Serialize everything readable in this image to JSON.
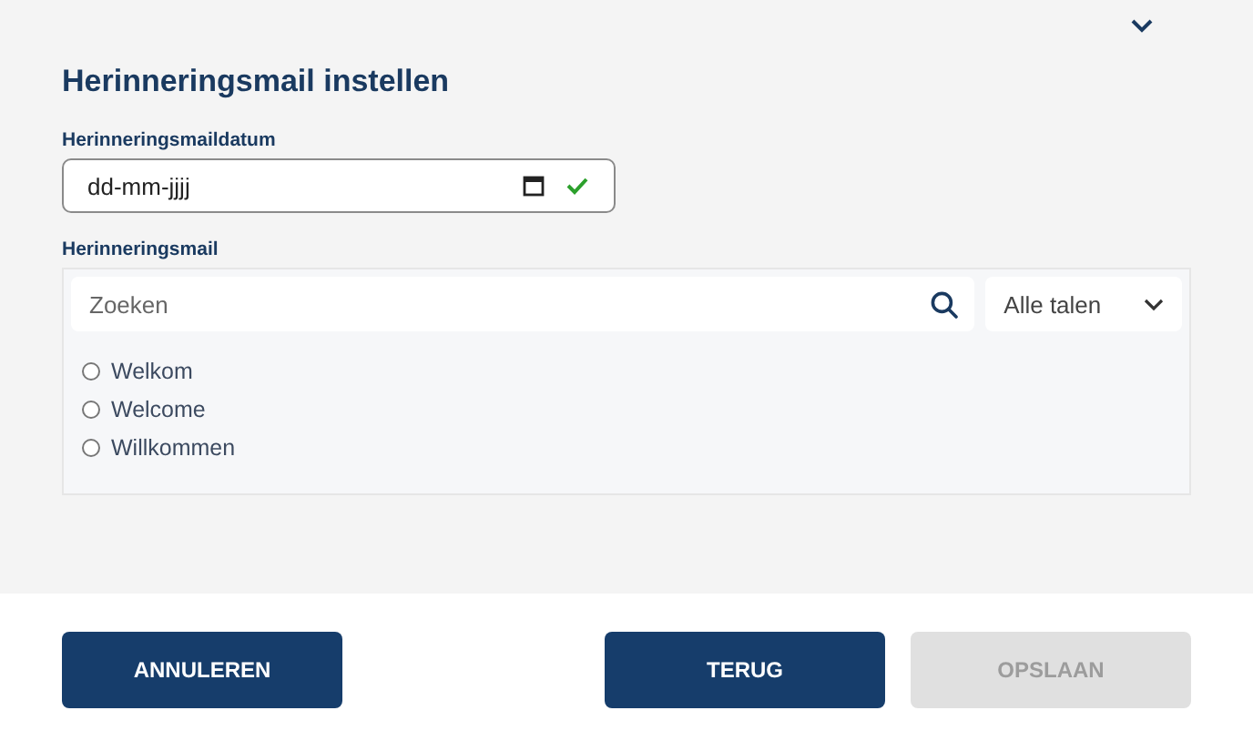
{
  "section": {
    "title": "Herinneringsmail instellen",
    "expanded": true
  },
  "date_field": {
    "label": "Herinneringsmaildatum",
    "placeholder": "dd-mm-jjjj",
    "valid": true
  },
  "mail_field": {
    "label": "Herinneringsmail",
    "search": {
      "placeholder": "Zoeken"
    },
    "language": {
      "value": "Alle talen"
    },
    "options": [
      {
        "label": "Welkom",
        "selected": false
      },
      {
        "label": "Welcome",
        "selected": false
      },
      {
        "label": "Willkommen",
        "selected": false
      }
    ]
  },
  "buttons": [
    {
      "label": "ANNULEREN",
      "disabled": false,
      "kind": "left"
    },
    {
      "label": "TERUG",
      "disabled": false,
      "kind": "right"
    },
    {
      "label": "OPSLAAN",
      "disabled": true,
      "kind": "right"
    }
  ]
}
